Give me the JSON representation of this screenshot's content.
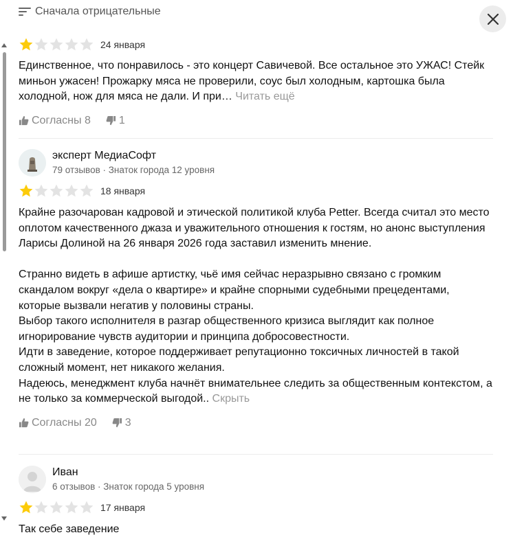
{
  "header": {
    "sort_label": "Сначала отрицательные"
  },
  "colors": {
    "star_filled": "#fccb0a",
    "star_empty": "#e3e3e3",
    "muted_text": "#999999"
  },
  "reviews": [
    {
      "rating": 1,
      "max_rating": 5,
      "date": "24 января",
      "text": "Единственное, что понравилось - это концерт Савичевой. Все остальное это УЖАС! Стейк миньон ужасен! Прожарку мяса не проверили, соус был холодным, картошка была холодной, нож для мяса не дали. И при…",
      "more_label": "Читать ещё",
      "likes_label": "Согласны 8",
      "dislikes_count": "1"
    },
    {
      "author_name": "эксперт МедиаСофт",
      "author_meta": "79 отзывов · Знаток города 12 уровня",
      "rating": 1,
      "max_rating": 5,
      "date": "18 января",
      "text": "Крайне разочарован кадровой и этической политикой клуба Petter. Всегда считал это место оплотом качественного джаза и уважительного отношения к гостям, но анонс выступления Ларисы Долиной на 26 января 2026 года заставил изменить мнение.\n\nСтранно видеть в афише артистку, чьё имя сейчас неразрывно связано с громким скандалом вокруг «дела о квартире» и крайне спорными судебными прецедентами, которые вызвали негатив у половины страны.\nВыбор такого исполнителя в разгар общественного кризиса выглядит как полное игнорирование чувств аудитории и принципа добросовестности.\nИдти в заведение, которое поддерживает репутационно токсичных личностей в такой сложный момент, нет никакого желания.\nНадеюсь, менеджмент клуба начнёт внимательнее следить за общественным контекстом, а не только за коммерческой выгодой..",
      "more_label": "Скрыть",
      "likes_label": "Согласны 20",
      "dislikes_count": "3"
    },
    {
      "author_name": "Иван",
      "author_meta": "6 отзывов · Знаток города 5 уровня",
      "rating": 1,
      "max_rating": 5,
      "date": "17 января",
      "text": "Так себе заведение"
    }
  ]
}
